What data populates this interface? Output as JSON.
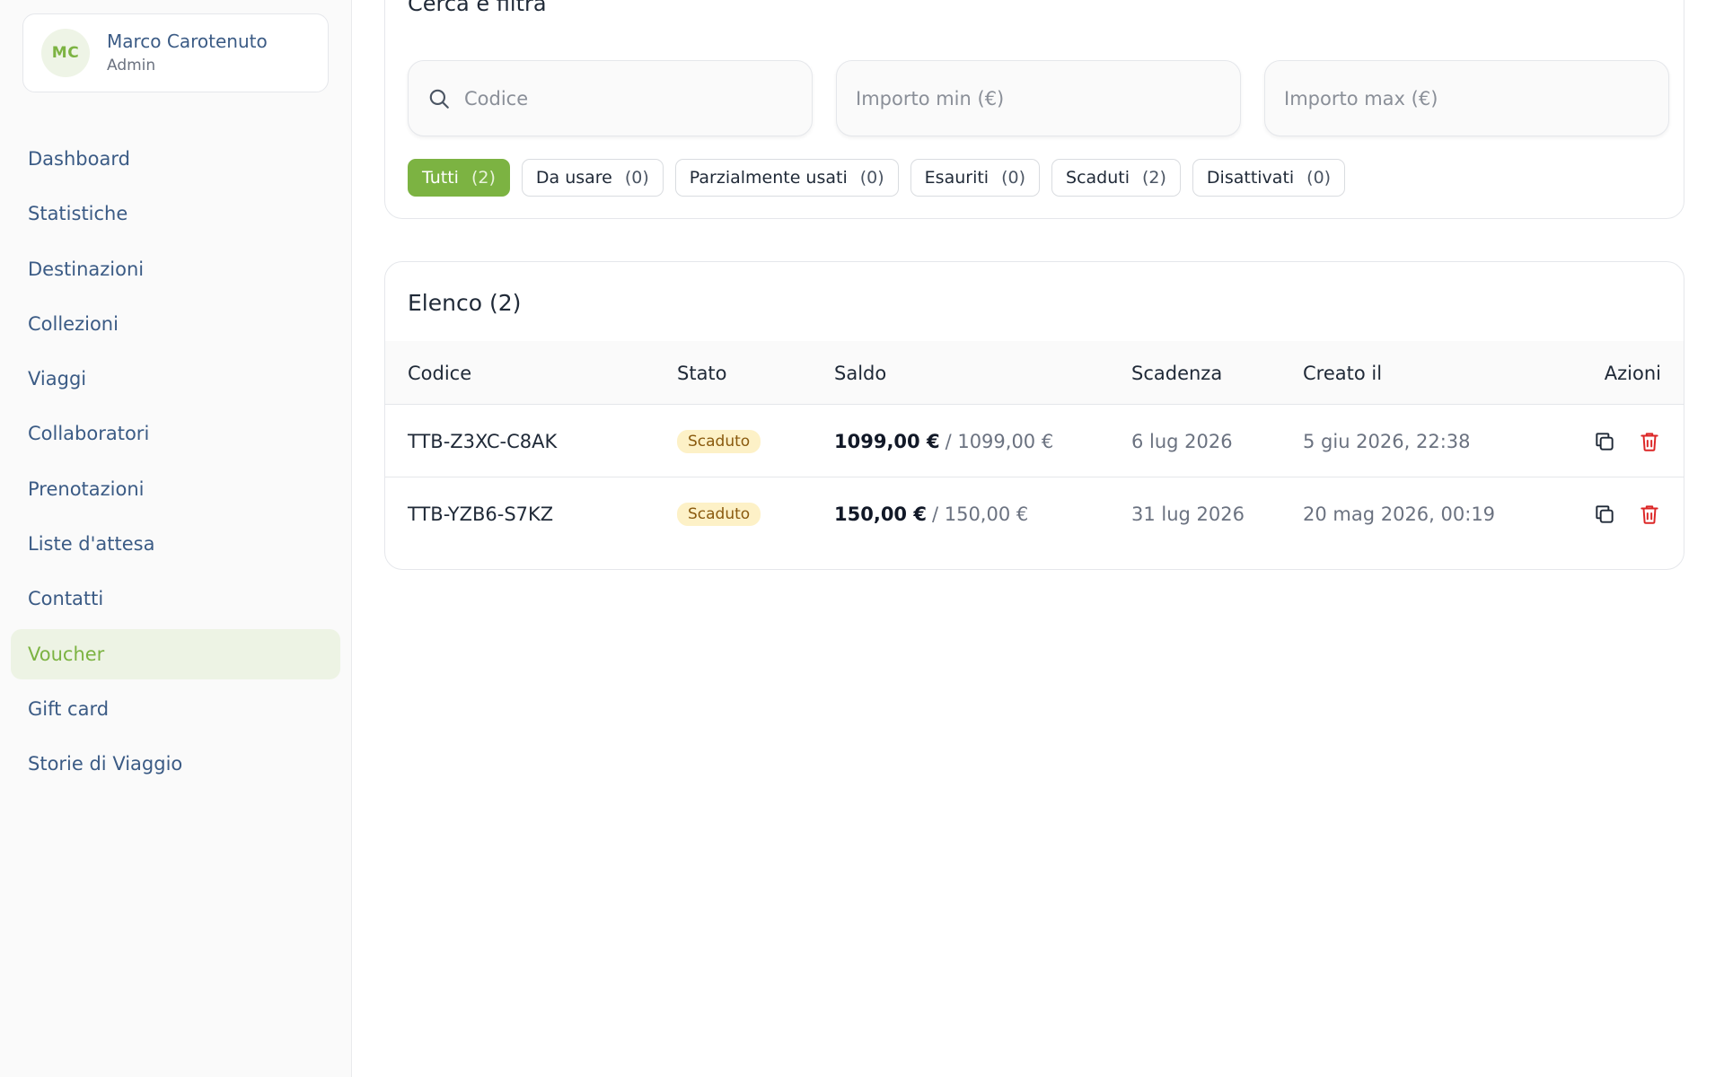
{
  "user": {
    "initials": "MC",
    "name": "Marco Carotenuto",
    "role": "Admin"
  },
  "nav": {
    "items": [
      {
        "label": "Dashboard",
        "active": false
      },
      {
        "label": "Statistiche",
        "active": false
      },
      {
        "label": "Destinazioni",
        "active": false
      },
      {
        "label": "Collezioni",
        "active": false
      },
      {
        "label": "Viaggi",
        "active": false
      },
      {
        "label": "Collaboratori",
        "active": false
      },
      {
        "label": "Prenotazioni",
        "active": false
      },
      {
        "label": "Liste d'attesa",
        "active": false
      },
      {
        "label": "Contatti",
        "active": false
      },
      {
        "label": "Voucher",
        "active": true
      },
      {
        "label": "Gift card",
        "active": false
      },
      {
        "label": "Storie di Viaggio",
        "active": false
      }
    ]
  },
  "filters": {
    "title": "Cerca e filtra",
    "code_placeholder": "Codice",
    "min_placeholder": "Importo min (€)",
    "max_placeholder": "Importo max (€)",
    "pills": [
      {
        "label": "Tutti",
        "count": "(2)",
        "active": true
      },
      {
        "label": "Da usare",
        "count": "(0)",
        "active": false
      },
      {
        "label": "Parzialmente usati",
        "count": "(0)",
        "active": false
      },
      {
        "label": "Esauriti",
        "count": "(0)",
        "active": false
      },
      {
        "label": "Scaduti",
        "count": "(2)",
        "active": false
      },
      {
        "label": "Disattivati",
        "count": "(0)",
        "active": false
      }
    ]
  },
  "list": {
    "title": "Elenco (2)",
    "columns": {
      "code": "Codice",
      "status": "Stato",
      "balance": "Saldo",
      "expiry": "Scadenza",
      "created": "Creato il",
      "actions": "Azioni"
    },
    "rows": [
      {
        "code": "TTB-Z3XC-C8AK",
        "status": "Scaduto",
        "balance": "1099,00 €",
        "total": "/ 1099,00 €",
        "expiry": "6 lug 2026",
        "created": "5 giu 2026, 22:38"
      },
      {
        "code": "TTB-YZB6-S7KZ",
        "status": "Scaduto",
        "balance": "150,00 €",
        "total": "/ 150,00 €",
        "expiry": "31 lug 2026",
        "created": "20 mag 2026, 00:19"
      }
    ]
  },
  "icons": {
    "search": "search-icon",
    "copy": "copy-icon",
    "delete": "trash-icon"
  },
  "colors": {
    "accent": "#7cb342",
    "nav_text": "#3b5b85",
    "badge_bg": "#fdf1c7",
    "badge_text": "#8a5a0e",
    "danger": "#dc2626"
  }
}
